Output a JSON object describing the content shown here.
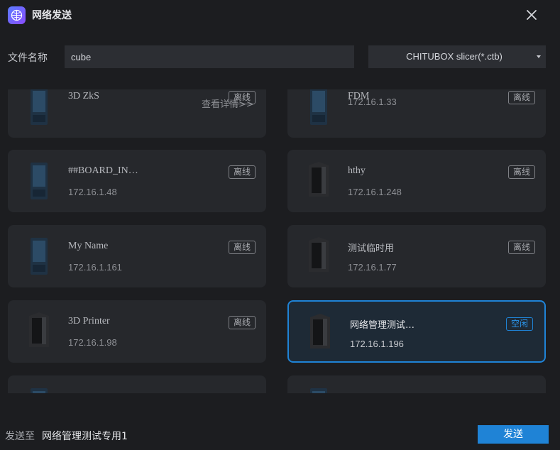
{
  "window": {
    "title": "网络发送",
    "close_icon": "close-icon",
    "app_icon": "network-send-app-icon"
  },
  "form": {
    "filename_label": "文件名称",
    "filename_value": "cube",
    "format_value": "CHITUBOX slicer(*.ctb)"
  },
  "devices": [
    {
      "name": "3D ZkS",
      "ip": "",
      "status": "离线",
      "details": "查看详情>>",
      "printer_style": "dark-blue",
      "selected": false
    },
    {
      "name": "FDM",
      "ip": "172.16.1.33",
      "status": "离线",
      "details": "",
      "printer_style": "dark-blue",
      "selected": false
    },
    {
      "name": "##BOARD_IN…",
      "ip": "172.16.1.48",
      "status": "离线",
      "details": "",
      "printer_style": "dark-blue",
      "selected": false
    },
    {
      "name": "hthy",
      "ip": "172.16.1.248",
      "status": "离线",
      "details": "",
      "printer_style": "black",
      "selected": false
    },
    {
      "name": "My Name",
      "ip": "172.16.1.161",
      "status": "离线",
      "details": "",
      "printer_style": "dark-blue",
      "selected": false
    },
    {
      "name": "测试临时用",
      "ip": "172.16.1.77",
      "status": "离线",
      "details": "",
      "printer_style": "black",
      "selected": false
    },
    {
      "name": "3D Printer",
      "ip": "172.16.1.98",
      "status": "离线",
      "details": "",
      "printer_style": "black",
      "selected": false
    },
    {
      "name": "网络管理测试…",
      "ip": "172.16.1.196",
      "status": "空闲",
      "details": "",
      "printer_style": "black",
      "selected": true
    }
  ],
  "footer": {
    "send_to_label": "发送至",
    "send_to_value": "网络管理测试专用1",
    "send_button": "发送"
  },
  "colors": {
    "accent": "#1f83d6",
    "background": "#1c1d20",
    "card": "#26282c"
  }
}
